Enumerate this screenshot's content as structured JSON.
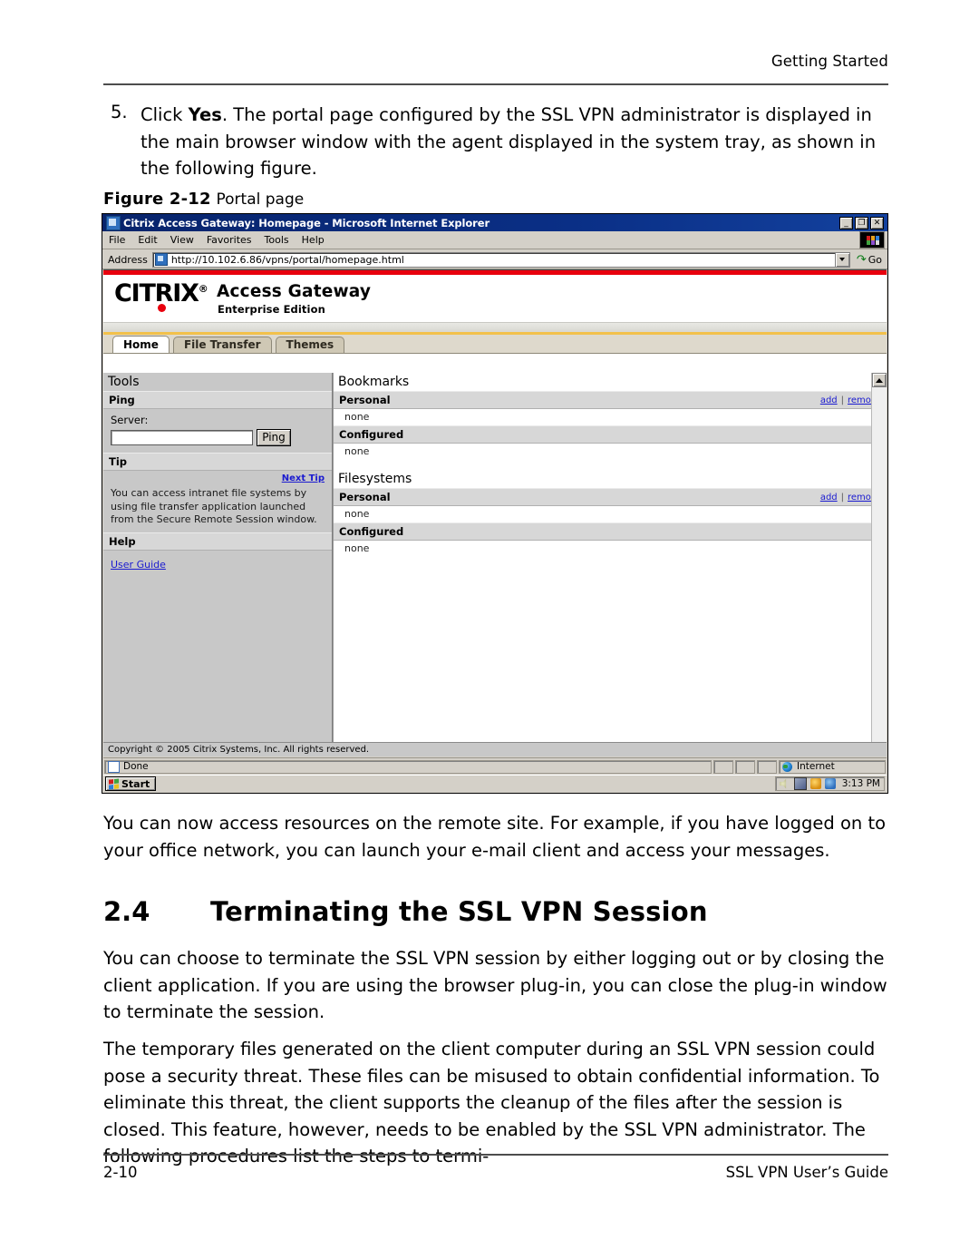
{
  "document": {
    "running_head": "Getting Started",
    "footer_page": "2-10",
    "footer_title": "SSL VPN User’s Guide"
  },
  "step": {
    "number": "5.",
    "text_before_bold": "Click ",
    "bold": "Yes",
    "text_after_bold": ". The portal page configured by the SSL VPN administrator is displayed in the main browser window with the agent displayed in the system tray, as shown in the following figure."
  },
  "figure": {
    "label": "Figure 2-12",
    "title": "Portal page"
  },
  "browser": {
    "title": "Citrix Access Gateway: Homepage - Microsoft Internet Explorer",
    "window_buttons": {
      "minimize": "_",
      "restore": "❐",
      "close": "✕"
    },
    "menu": [
      "File",
      "Edit",
      "View",
      "Favorites",
      "Tools",
      "Help"
    ],
    "address": {
      "label": "Address",
      "url": "http://10.102.6.86/vpns/portal/homepage.html",
      "go_label": "Go",
      "go_icon": "go-arrow-icon",
      "dropdown_icon": "chevron-down-icon"
    },
    "statusbar": {
      "status": "Done",
      "zone": "Internet",
      "zone_icon": "globe-icon",
      "doc_icon": "page-icon"
    },
    "taskbar": {
      "start_label": "Start",
      "start_icon": "windows-flag-icon",
      "clock": "3:13 PM",
      "tray_icons": [
        "volume-icon",
        "network-icon",
        "shield-icon",
        "vpn-agent-icon"
      ]
    }
  },
  "portal": {
    "brand": {
      "logo_text": "CITRIX",
      "logo_mark": "®",
      "product": "Access Gateway",
      "edition": "Enterprise Edition"
    },
    "tabs": [
      {
        "label": "Home",
        "active": true
      },
      {
        "label": "File Transfer",
        "active": false
      },
      {
        "label": "Themes",
        "active": false
      }
    ],
    "left": {
      "heading": "Tools",
      "ping": {
        "heading": "Ping",
        "field_label": "Server:",
        "field_value": "",
        "button_label": "Ping"
      },
      "tip": {
        "heading": "Tip",
        "next_link": "Next Tip",
        "text": "You can access intranet file systems by using file transfer application launched from the Secure Remote Session window."
      },
      "help": {
        "heading": "Help",
        "link": "User Guide"
      }
    },
    "right": {
      "sections": [
        {
          "heading": "Bookmarks",
          "groups": [
            {
              "label": "Personal",
              "add": "add",
              "separator": "|",
              "remove": "remove",
              "value": "none",
              "has_actions": true
            },
            {
              "label": "Configured",
              "value": "none",
              "has_actions": false
            }
          ]
        },
        {
          "heading": "Filesystems",
          "groups": [
            {
              "label": "Personal",
              "add": "add",
              "separator": "|",
              "remove": "remove",
              "value": "none",
              "has_actions": true
            },
            {
              "label": "Configured",
              "value": "none",
              "has_actions": false
            }
          ]
        }
      ]
    },
    "copyright": "Copyright © 2005 Citrix Systems, Inc. All rights reserved."
  },
  "body": {
    "paragraph_1": "You can now access resources on the remote site. For example, if you have logged on to your office network, you can launch your e-mail client and access your messages.",
    "section_number": "2.4",
    "section_title": "Terminating the SSL VPN Session",
    "paragraph_2": "You can choose to terminate the SSL VPN session by either logging out or by closing the client application. If you are using the browser plug-in, you can close the plug-in window to terminate the session.",
    "paragraph_3": "The temporary files generated on the client computer during an SSL VPN session could pose a security threat. These files can be misused to obtain confidential information. To eliminate this threat, the client supports the cleanup of the files after the session is closed. This feature, however, needs to be enabled by the SSL VPN administrator. The following procedures list the steps to termi-"
  },
  "colors": {
    "citrix_red": "#e8000d",
    "gold_rule": "#f2c14b",
    "link_blue": "#1a1ad0",
    "titlebar_blue": "#0a2f86"
  }
}
